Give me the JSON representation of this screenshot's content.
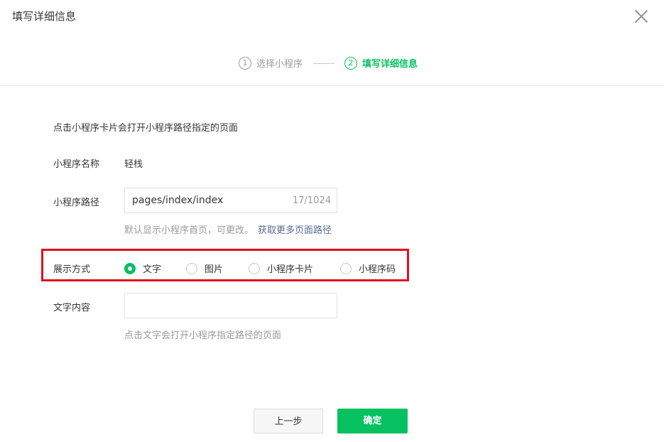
{
  "dialog": {
    "title": "填写详细信息"
  },
  "steps": [
    {
      "num": "1",
      "label": "选择小程序",
      "active": false
    },
    {
      "num": "2",
      "label": "填写详细信息",
      "active": true
    }
  ],
  "description": "点击小程序卡片会打开小程序路径指定的页面",
  "fields": {
    "name_label": "小程序名称",
    "name_value": "轻栈",
    "path_label": "小程序路径",
    "path_value": "pages/index/index",
    "path_counter": "17/1024",
    "path_hint": "默认显示小程序首页，可更改。",
    "path_hint_link": "获取更多页面路径",
    "display_label": "展示方式",
    "display_options": [
      "文字",
      "图片",
      "小程序卡片",
      "小程序码"
    ],
    "display_selected": "文字",
    "text_label": "文字内容",
    "text_value": "",
    "text_hint": "点击文字会打开小程序指定路径的页面"
  },
  "buttons": {
    "prev": "上一步",
    "confirm": "确定"
  },
  "colors": {
    "accent": "#07c160",
    "link": "#576b95",
    "highlight_border": "#e0121f"
  }
}
